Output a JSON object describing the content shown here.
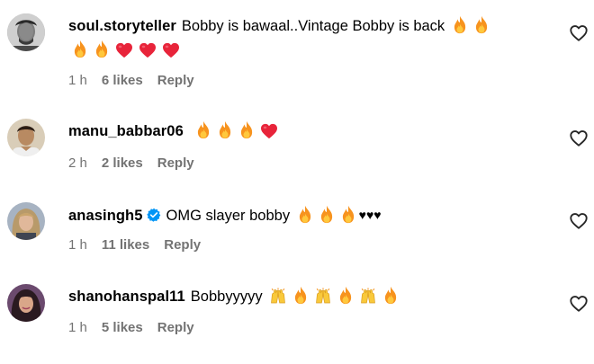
{
  "comments": [
    {
      "username": "soul.storyteller",
      "text": "Bobby is bawaal..Vintage Bobby is back",
      "time": "1 h",
      "likes": "6 likes",
      "reply": "Reply",
      "verified": false,
      "emojis_line1": [
        "fire",
        "fire"
      ],
      "emojis_line2": [
        "fire",
        "fire",
        "red-heart",
        "red-heart",
        "red-heart"
      ]
    },
    {
      "username": "manu_babbar06",
      "text": "",
      "time": "2 h",
      "likes": "2 likes",
      "reply": "Reply",
      "verified": false,
      "emojis": [
        "fire",
        "fire",
        "fire",
        "red-heart"
      ]
    },
    {
      "username": "anasingh5",
      "text": "OMG slayer bobby",
      "time": "1 h",
      "likes": "11 likes",
      "reply": "Reply",
      "verified": true,
      "emojis": [
        "fire",
        "fire",
        "fire"
      ],
      "trailing": "♥♥♥"
    },
    {
      "username": "shanohanspal11",
      "text": "Bobbyyyyy",
      "time": "1 h",
      "likes": "5 likes",
      "reply": "Reply",
      "verified": false,
      "emojis": [
        "raising-hands",
        "fire",
        "raising-hands",
        "fire",
        "raising-hands",
        "fire"
      ]
    }
  ],
  "icons": {
    "like": "heart-outline-icon",
    "verified": "verified-badge-icon"
  },
  "colors": {
    "meta_text": "#737373",
    "verified_blue": "#0095F6",
    "fire_orange": "#F7931E",
    "heart_red": "#E8243A"
  }
}
